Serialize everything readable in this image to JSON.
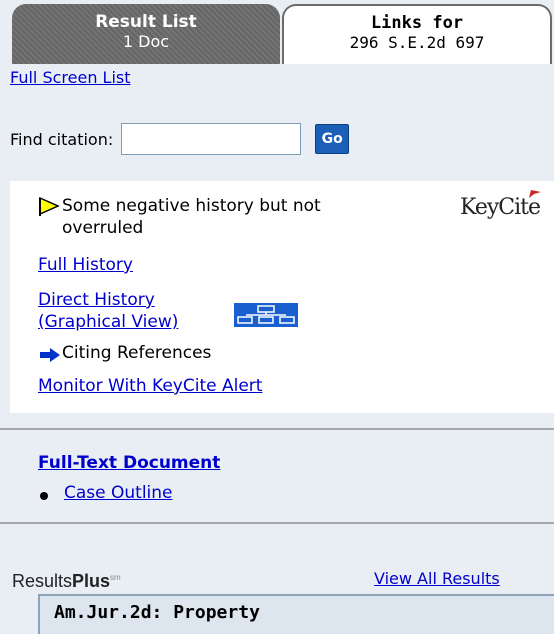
{
  "tabs": {
    "result_list": {
      "title": "Result List",
      "subtitle": "1 Doc"
    },
    "links_for": {
      "title": "Links for",
      "subtitle": "296 S.E.2d 697"
    }
  },
  "full_screen_list": "Full Screen List",
  "find_citation": {
    "label": "Find citation:",
    "value": "",
    "go_label": "Go"
  },
  "keycite": {
    "status_text": "Some negative history but not overruled",
    "status_flag_color": "#ffff00",
    "logo_text": "KeyCite",
    "full_history": "Full History",
    "direct_history_line1": "Direct History",
    "direct_history_line2": "(Graphical View)",
    "citing_references": "Citing References",
    "monitor": "Monitor With KeyCite Alert"
  },
  "document_links": {
    "full_text": "Full-Text Document",
    "case_outline": "Case Outline"
  },
  "results_plus": {
    "brand_prefix": "Results",
    "brand_bold": "Plus",
    "brand_mark": "sm",
    "view_all": "View All Results",
    "first_result": "Am.Jur.2d: Property"
  }
}
